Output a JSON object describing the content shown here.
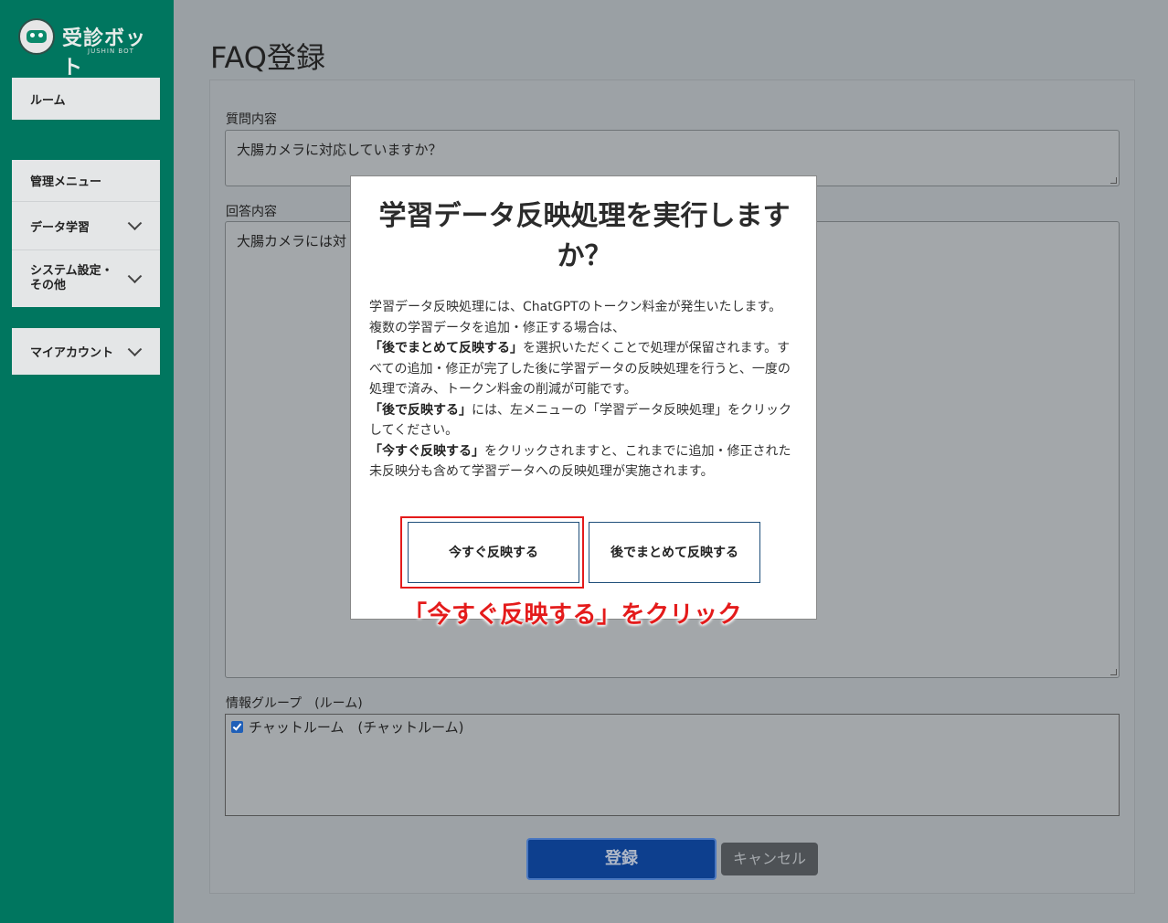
{
  "app": {
    "logo_text": "受診ボット",
    "logo_sub": "JUSHIN BOT"
  },
  "sidebar": {
    "room": "ルーム",
    "admin_menu": "管理メニュー",
    "data_learning": "データ学習",
    "system_settings": "システム設定・その他",
    "my_account": "マイアカウント"
  },
  "page": {
    "title": "FAQ登録",
    "question_label": "質問内容",
    "question_value": "大腸カメラに対応していますか？",
    "answer_label": "回答内容",
    "answer_value": "大腸カメラには対",
    "group_label": "情報グループ　(ルーム)",
    "group_item": "チャットルーム　(チャットルーム)",
    "submit_label": "登録",
    "cancel_label": "キャンセル"
  },
  "modal": {
    "title": "学習データ反映処理を実行しますか？",
    "p1": "学習データ反映処理には、ChatGPTのトークン料金が発生いたします。",
    "p2": "複数の学習データを追加・修正する場合は、",
    "p3_bold": "「後でまとめて反映する」",
    "p3_rest": "を選択いただくことで処理が保留されます。すべての追加・修正が完了した後に学習データの反映処理を行うと、一度の処理で済み、トークン料金の削減が可能です。",
    "p4_bold": "「後で反映する」",
    "p4_rest": "には、左メニューの「学習データ反映処理」をクリックしてください。",
    "p5_bold": "「今すぐ反映する」",
    "p5_rest": "をクリックされますと、これまでに追加・修正された未反映分も含めて学習データへの反映処理が実施されます。",
    "btn_now": "今すぐ反映する",
    "btn_later": "後でまとめて反映する"
  },
  "annotation": {
    "text": "「今すぐ反映する」をクリック",
    "color": "#e41b1b"
  }
}
